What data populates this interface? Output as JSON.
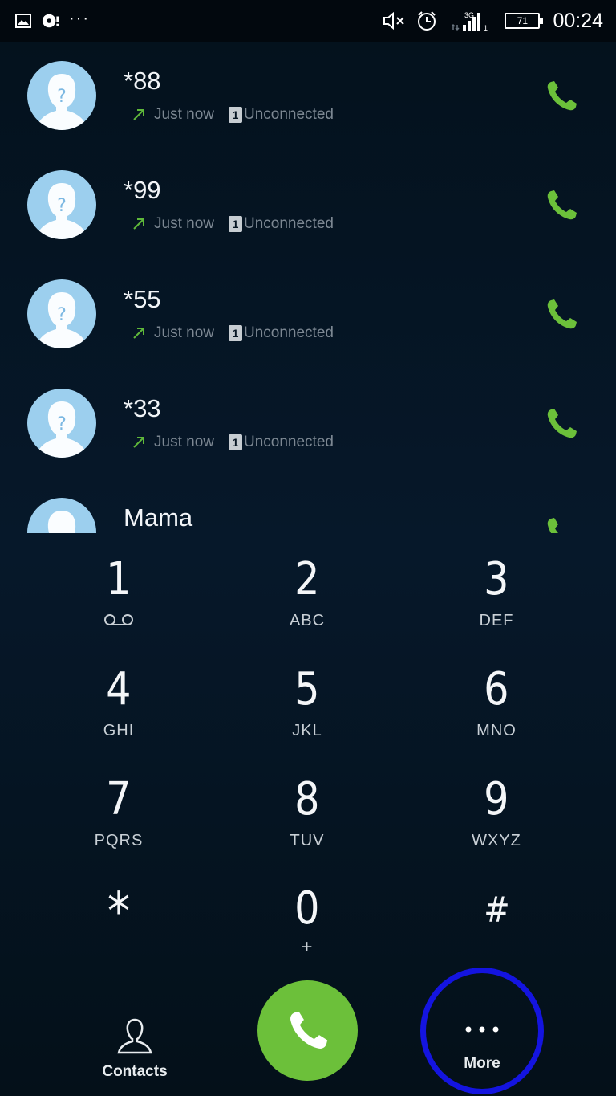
{
  "status_bar": {
    "time": "00:24",
    "battery_level": "71",
    "network_type": "3G",
    "left_icons": [
      "gallery-icon",
      "sync-icon",
      "more-notifications-icon"
    ],
    "right_icons": [
      "mute-icon",
      "alarm-icon",
      "data-arrows-icon",
      "signal-icon",
      "sim-1-icon",
      "battery-icon"
    ]
  },
  "call_log": [
    {
      "name": "*88",
      "time": "Just now",
      "sim": "1",
      "status": "Unconnected",
      "direction": "outgoing"
    },
    {
      "name": "*99",
      "time": "Just now",
      "sim": "1",
      "status": "Unconnected",
      "direction": "outgoing"
    },
    {
      "name": "*55",
      "time": "Just now",
      "sim": "1",
      "status": "Unconnected",
      "direction": "outgoing"
    },
    {
      "name": "*33",
      "time": "Just now",
      "sim": "1",
      "status": "Unconnected",
      "direction": "outgoing"
    },
    {
      "name": "Mama",
      "time": "",
      "sim": "",
      "status": "",
      "direction": ""
    }
  ],
  "dialpad": {
    "keys": [
      {
        "digit": "1",
        "letters": "",
        "extra_icon": "voicemail-icon"
      },
      {
        "digit": "2",
        "letters": "ABC"
      },
      {
        "digit": "3",
        "letters": "DEF"
      },
      {
        "digit": "4",
        "letters": "GHI"
      },
      {
        "digit": "5",
        "letters": "JKL"
      },
      {
        "digit": "6",
        "letters": "MNO"
      },
      {
        "digit": "7",
        "letters": "PQRS"
      },
      {
        "digit": "8",
        "letters": "TUV"
      },
      {
        "digit": "9",
        "letters": "WXYZ"
      },
      {
        "digit": "*",
        "letters": ""
      },
      {
        "digit": "0",
        "letters": "+"
      },
      {
        "digit": "#",
        "letters": ""
      }
    ]
  },
  "bottom_bar": {
    "contacts_label": "Contacts",
    "more_label": "More",
    "call_icon": "phone-icon"
  },
  "colors": {
    "accent_green": "#6cc03a",
    "highlight_ring": "#1414e0",
    "background": "#061522",
    "avatar": "#9ccfee"
  }
}
